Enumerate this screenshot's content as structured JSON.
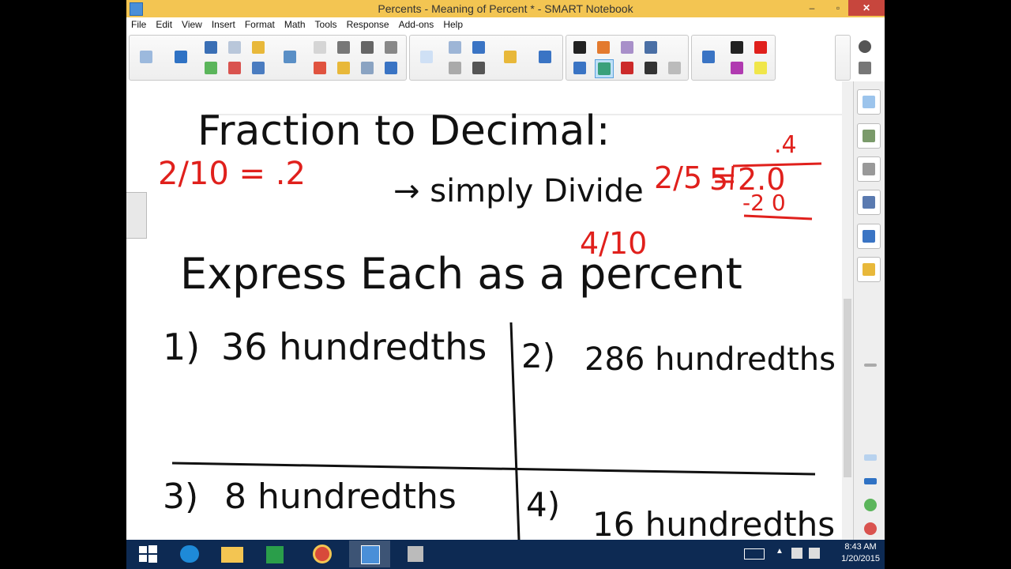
{
  "window": {
    "title": "Percents - Meaning of Percent * - SMART Notebook",
    "controls": {
      "minimize": "–",
      "restore": "▫",
      "close": "✕"
    }
  },
  "menu": [
    "File",
    "Edit",
    "View",
    "Insert",
    "Format",
    "Math",
    "Tools",
    "Response",
    "Add-ons",
    "Help"
  ],
  "page": {
    "heading": "Fraction to Decimal:",
    "example_left": "2/10 = .2",
    "hint": "→ simply Divide",
    "example_right_fraction": "2/5 =",
    "division_divisor": "5",
    "division_dividend": "2.0",
    "division_quotient": ".4",
    "division_subtract": "-2 0",
    "result": "4/10",
    "prompt": "Express Each as a percent",
    "problems": [
      {
        "num": "1)",
        "text": "36 hundredths"
      },
      {
        "num": "2)",
        "text": "286 hundredths"
      },
      {
        "num": "3)",
        "text": "8 hundredths"
      },
      {
        "num": "4)",
        "text": "16 hundredths"
      }
    ],
    "ink_black": "#111111",
    "ink_red": "#e0201c"
  },
  "taskbar": {
    "clock_time": "8:43 AM",
    "clock_date": "1/20/2015",
    "color": "#0d2a53"
  }
}
